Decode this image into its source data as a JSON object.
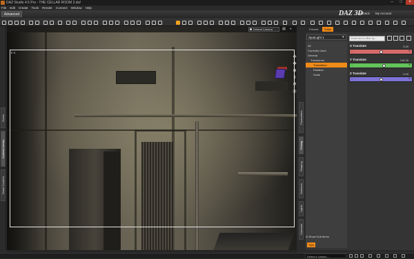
{
  "window": {
    "title": "DAZ Studio 4.5 Pro - THE CELLAR ROOM 2.duf",
    "controls": [
      "–",
      "□",
      "×"
    ]
  },
  "menu": [
    "File",
    "Edit",
    "Create",
    "Tools",
    "Render",
    "Connect",
    "Window",
    "Help"
  ],
  "layout_tab": "Advanced",
  "header": {
    "logo": "DAZ 3D",
    "feedback": "Feedback",
    "account": "My Account"
  },
  "viewport": {
    "camera": "Default Camera",
    "frame_label": "E E"
  },
  "left_tabs": [
    "Scene",
    "Content Library",
    "Smart Content"
  ],
  "right_tabs": [
    "Parameters",
    "Posing",
    "Shaping",
    "Surfaces",
    "Lights",
    "Cameras"
  ],
  "pane": {
    "tabs": [
      "Presets",
      "Editor"
    ],
    "active_tab": "Editor",
    "node": "SpotLight 1",
    "filter_placeholder": "Enter text to filter by...",
    "tree": [
      "All",
      "Currently Used",
      "General",
      "Transforms",
      "Translation",
      "Rotation",
      "Scale"
    ],
    "tree_active": "Translation",
    "show_sub_items": "Show Sub Items",
    "footer_btn": "Tips"
  },
  "params": [
    {
      "label": "X Translate",
      "value": "0.00",
      "color": "#d66a6a",
      "fraction": 0.5
    },
    {
      "label": "Y Translate",
      "value": "146.26",
      "color": "#64c25a",
      "fraction": 0.55
    },
    {
      "label": "Z Translate",
      "value": "0.00",
      "color": "#7d72d6",
      "fraction": 0.5
    }
  ],
  "status": {
    "lesson_placeholder": "Select a Lesson..."
  },
  "colors": {
    "accent": "#f08a18"
  }
}
